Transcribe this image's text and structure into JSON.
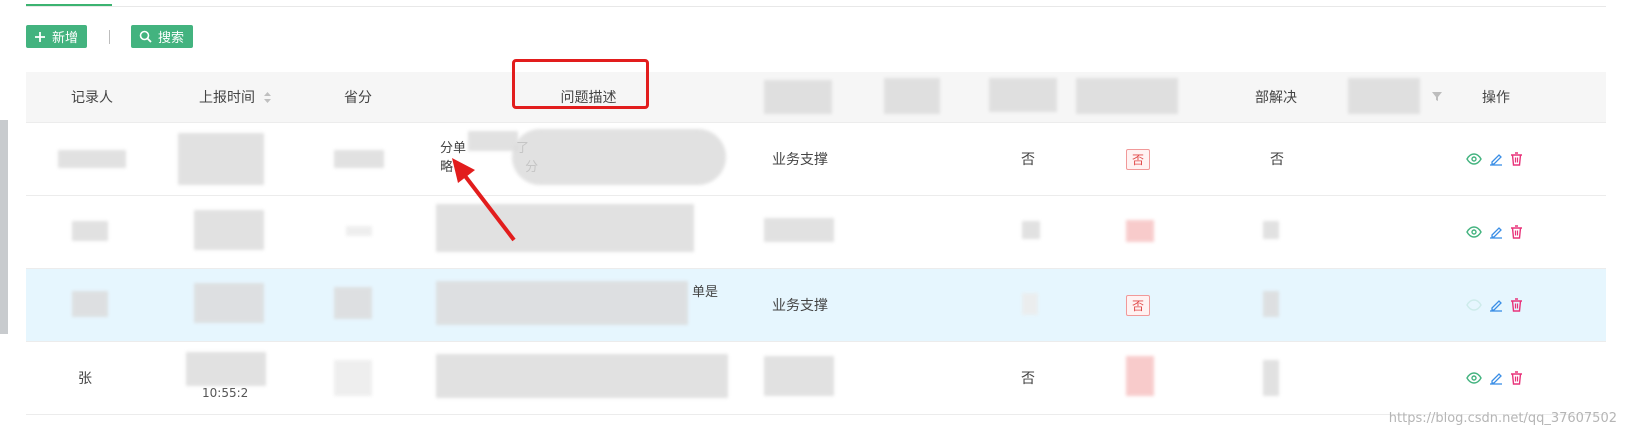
{
  "toolbar": {
    "add_label": "新增",
    "search_label": "搜索"
  },
  "table": {
    "headers": {
      "recorder": "记录人",
      "report_time": "上报时间",
      "province": "省分",
      "problem_desc": "问题描述",
      "resolved": "部解决",
      "actions": "操作"
    },
    "rows": [
      {
        "desc_line1": "分单",
        "desc_frag2": "了",
        "desc_line2": "略",
        "desc_frag3": "分",
        "category": "业务支撑",
        "flag1": "否",
        "badge": "否",
        "resolved": "否"
      },
      {
        "category": "",
        "flag1": "",
        "badge": "",
        "resolved": ""
      },
      {
        "desc_frag": "单是",
        "category": "业务支撑",
        "badge": "否"
      },
      {
        "recorder": "张",
        "time": "10:55:2",
        "flag1": "否"
      }
    ]
  },
  "watermark": "https://blog.csdn.net/qq_37607502",
  "colors": {
    "primary_green": "#43b37f",
    "highlight_row": "#e6f6fe",
    "annotation_red": "#e21d1d",
    "badge_red": "#e04848"
  }
}
